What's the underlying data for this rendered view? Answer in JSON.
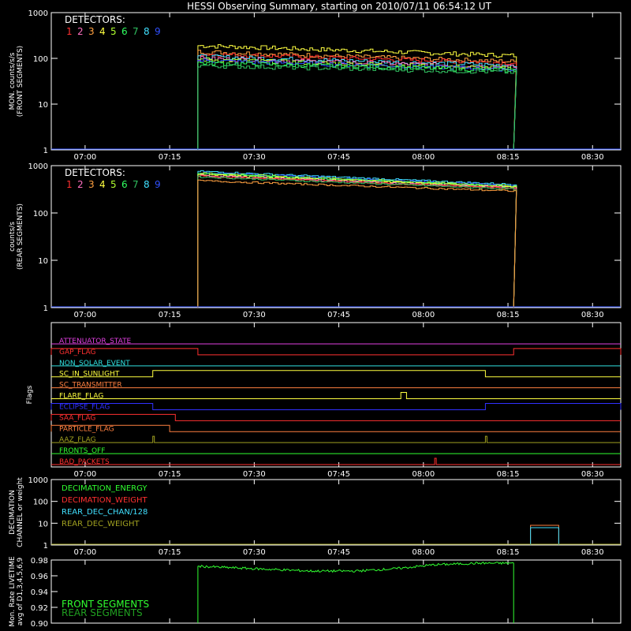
{
  "title": "HESSI Observing Summary, starting on 2010/07/11 06:54:12 UT",
  "x_ticks": [
    "07:00",
    "07:15",
    "07:30",
    "07:45",
    "08:00",
    "08:15",
    "08:30"
  ],
  "colors": {
    "det1": "#ff3030",
    "det2": "#ff70c0",
    "det3": "#ffa040",
    "det4": "#ffff40",
    "det5": "#b0ff30",
    "det6": "#30ff60",
    "det7": "#30c060",
    "det8": "#40e0ff",
    "det9": "#3050ff"
  },
  "chart_data": [
    {
      "id": "front",
      "type": "line",
      "ylabel": "MON. counts/s/s\n(FRONT SEGMENTS)",
      "y_scale": "log",
      "ylim": [
        1,
        1000
      ],
      "y_ticks": [
        "1",
        "10",
        "100",
        "1000"
      ],
      "legend_title": "DETECTORS:",
      "legend_items": [
        "1",
        "2",
        "3",
        "4",
        "5",
        "6",
        "7",
        "8",
        "9"
      ],
      "x_start": "07:20",
      "x_end": "08:16",
      "series": [
        {
          "color": "det4",
          "start": 190,
          "end": 115
        },
        {
          "color": "det3",
          "start": 140,
          "end": 85
        },
        {
          "color": "det1",
          "start": 125,
          "end": 80
        },
        {
          "color": "det8",
          "start": 110,
          "end": 70
        },
        {
          "color": "det2",
          "start": 100,
          "end": 65
        },
        {
          "color": "det5",
          "start": 95,
          "end": 60
        },
        {
          "color": "det9",
          "start": 90,
          "end": 58
        },
        {
          "color": "det6",
          "start": 80,
          "end": 55
        },
        {
          "color": "det7",
          "start": 70,
          "end": 50
        }
      ]
    },
    {
      "id": "rear",
      "type": "line",
      "ylabel": "counts/s\n(REAR SEGMENTS)",
      "y_scale": "log",
      "ylim": [
        1,
        1000
      ],
      "y_ticks": [
        "1",
        "10",
        "100",
        "1000"
      ],
      "legend_title": "DETECTORS:",
      "legend_items": [
        "1",
        "2",
        "3",
        "4",
        "5",
        "6",
        "7",
        "8",
        "9"
      ],
      "x_start": "07:20",
      "x_end": "08:16",
      "series": [
        {
          "color": "det8",
          "start": 760,
          "end": 400
        },
        {
          "color": "det9",
          "start": 720,
          "end": 380
        },
        {
          "color": "det5",
          "start": 700,
          "end": 370
        },
        {
          "color": "det6",
          "start": 680,
          "end": 360
        },
        {
          "color": "det4",
          "start": 650,
          "end": 350
        },
        {
          "color": "det2",
          "start": 620,
          "end": 340
        },
        {
          "color": "det1",
          "start": 600,
          "end": 330
        },
        {
          "color": "det7",
          "start": 580,
          "end": 320
        },
        {
          "color": "det3",
          "start": 480,
          "end": 290
        }
      ]
    },
    {
      "id": "flags",
      "type": "line",
      "ylabel": "Flags",
      "flags": [
        {
          "label": "ATTENUATOR_STATE",
          "color": "#e040e0",
          "segments": []
        },
        {
          "label": "GAP_FLAG",
          "color": "#ff3030",
          "segments": [
            [
              "06:54",
              "07:20"
            ],
            [
              "08:16",
              "08:35"
            ]
          ]
        },
        {
          "label": "NON_SOLAR_EVENT",
          "color": "#30e0e0",
          "segments": []
        },
        {
          "label": "SC_IN_SUNLIGHT",
          "color": "#ffff40",
          "segments": [
            [
              "07:12",
              "08:11"
            ]
          ]
        },
        {
          "label": "SC_TRANSMITTER",
          "color": "#ff8040",
          "segments": []
        },
        {
          "label": "FLARE_FLAG",
          "color": "#ffff40",
          "segments": [
            [
              "07:56",
              "07:57"
            ]
          ]
        },
        {
          "label": "ECLIPSE_FLAG",
          "color": "#3030ff",
          "segments": [
            [
              "06:54",
              "07:12"
            ],
            [
              "08:11",
              "08:35"
            ]
          ]
        },
        {
          "label": "SAA_FLAG",
          "color": "#ff3030",
          "segments": [
            [
              "06:54",
              "07:16"
            ]
          ]
        },
        {
          "label": "PARTICLE_FLAG",
          "color": "#ff8040",
          "segments": [
            [
              "06:54",
              "07:15"
            ]
          ]
        },
        {
          "label": "AAZ_FLAG",
          "color": "#a0a020",
          "segments": [
            [
              "07:12",
              "07:12"
            ],
            [
              "08:11",
              "08:11"
            ]
          ]
        },
        {
          "label": "FRONTS_OFF",
          "color": "#30ff30",
          "segments": []
        },
        {
          "label": "BAD_PACKETS",
          "color": "#ff3030",
          "segments": [
            [
              "08:02",
              "08:02"
            ]
          ]
        }
      ]
    },
    {
      "id": "decimation",
      "type": "line",
      "ylabel": "DECIMATION\nCHANNEL or weight",
      "y_scale": "log",
      "ylim": [
        1,
        1000
      ],
      "y_ticks": [
        "1",
        "10",
        "100",
        "1000"
      ],
      "legend": [
        {
          "label": "DECIMATION_ENERGY",
          "color": "#30ff30"
        },
        {
          "label": "DECIMATION_WEIGHT",
          "color": "#ff3030"
        },
        {
          "label": "REAR_DEC_CHAN/128",
          "color": "#40e0ff"
        },
        {
          "label": "REAR_DEC_WEIGHT",
          "color": "#a0a020"
        }
      ],
      "steps": [
        {
          "color": "#ff8040",
          "start": "08:19",
          "end": "08:24",
          "value": 8
        },
        {
          "color": "#40e0ff",
          "start": "08:19",
          "end": "08:24",
          "value": 8
        }
      ]
    },
    {
      "id": "livetime",
      "type": "line",
      "ylabel": "Mon. Rate LIVETIME\navg of D1,3,4,5,6,9",
      "ylim": [
        0.9,
        0.98
      ],
      "y_ticks": [
        "0.90",
        "0.92",
        "0.94",
        "0.96",
        "0.98"
      ],
      "x_start": "07:20",
      "x_end": "08:16",
      "curve": [
        {
          "t": "07:20",
          "v": 0.972
        },
        {
          "t": "07:30",
          "v": 0.969
        },
        {
          "t": "07:40",
          "v": 0.966
        },
        {
          "t": "07:48",
          "v": 0.966
        },
        {
          "t": "07:55",
          "v": 0.969
        },
        {
          "t": "08:02",
          "v": 0.974
        },
        {
          "t": "08:10",
          "v": 0.976
        },
        {
          "t": "08:16",
          "v": 0.976
        }
      ],
      "legend": [
        {
          "label": "FRONT SEGMENTS",
          "color": "#30ff30"
        },
        {
          "label": "REAR SEGMENTS",
          "color": "#20a020"
        }
      ]
    }
  ]
}
